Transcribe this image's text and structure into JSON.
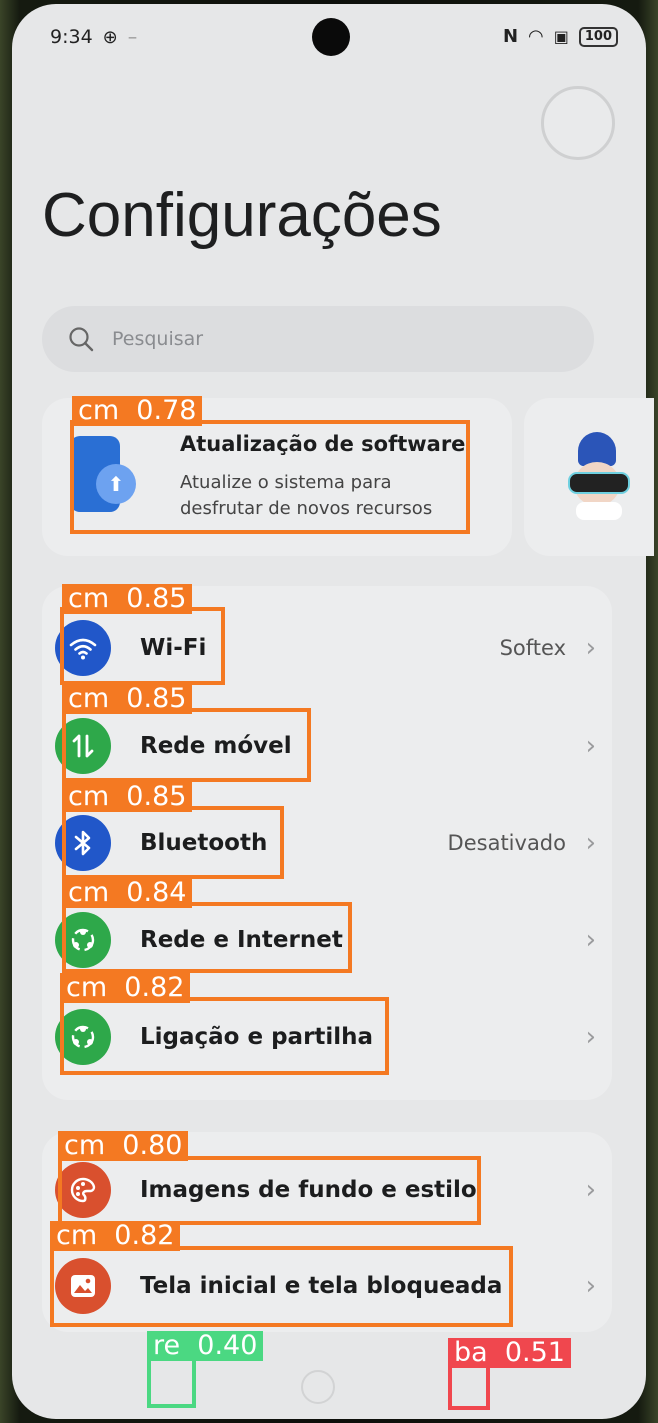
{
  "status_bar": {
    "time": "9:34",
    "battery": "100",
    "nfc": "N"
  },
  "page_title": "Configurações",
  "search": {
    "placeholder": "Pesquisar"
  },
  "update_card": {
    "title": "Atualização de software",
    "description": "Atualize o sistema para desfrutar de novos recursos"
  },
  "settings_group_1": [
    {
      "label": "Wi-Fi",
      "value": "Softex",
      "icon": "wifi-icon",
      "color": "#2157c9"
    },
    {
      "label": "Rede móvel",
      "value": "",
      "icon": "mobile-data-icon",
      "color": "#2ea84a"
    },
    {
      "label": "Bluetooth",
      "value": "Desativado",
      "icon": "bluetooth-icon",
      "color": "#2157c9"
    },
    {
      "label": "Rede e Internet",
      "value": "",
      "icon": "share-network-icon",
      "color": "#2ea84a"
    },
    {
      "label": "Ligação e partilha",
      "value": "",
      "icon": "share-network-icon",
      "color": "#2ea84a"
    }
  ],
  "settings_group_2": [
    {
      "label": "Imagens de fundo e estilo",
      "icon": "palette-icon",
      "color": "#d9502e"
    },
    {
      "label": "Tela inicial e tela bloqueada",
      "icon": "image-icon",
      "color": "#d9502e"
    }
  ],
  "detections": [
    {
      "label": "cm  0.78",
      "color": "#f47922"
    },
    {
      "label": "cm  0.85",
      "color": "#f47922"
    },
    {
      "label": "cm  0.85",
      "color": "#f47922"
    },
    {
      "label": "cm  0.85",
      "color": "#f47922"
    },
    {
      "label": "cm  0.84",
      "color": "#f47922"
    },
    {
      "label": "cm  0.82",
      "color": "#f47922"
    },
    {
      "label": "cm  0.80",
      "color": "#f47922"
    },
    {
      "label": "cm  0.82",
      "color": "#f47922"
    },
    {
      "label": "re  0.40",
      "color": "#4bd882"
    },
    {
      "label": "ba  0.51",
      "color": "#f0474e"
    }
  ]
}
